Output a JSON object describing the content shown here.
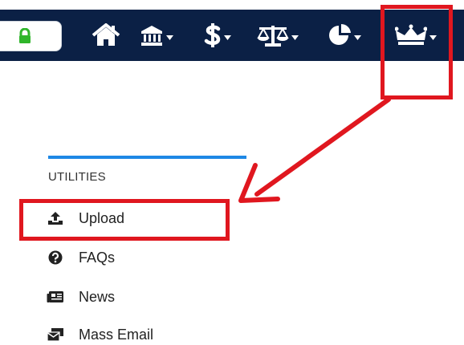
{
  "navbar": {
    "icons": [
      "lock-icon",
      "home-icon",
      "bank-icon",
      "dollar-icon",
      "balance-scale-icon",
      "pie-chart-icon",
      "crown-icon"
    ],
    "colors": {
      "background": "#0b2045",
      "accent": "#2fb52a"
    }
  },
  "utilities": {
    "title": "UTILITIES",
    "items": [
      {
        "label": "Upload",
        "icon": "upload-icon"
      },
      {
        "label": "FAQs",
        "icon": "question-circle-icon"
      },
      {
        "label": "News",
        "icon": "newspaper-icon"
      },
      {
        "label": "Mass Email",
        "icon": "mass-email-icon"
      }
    ]
  },
  "annotation": {
    "color": "#e0171f"
  }
}
